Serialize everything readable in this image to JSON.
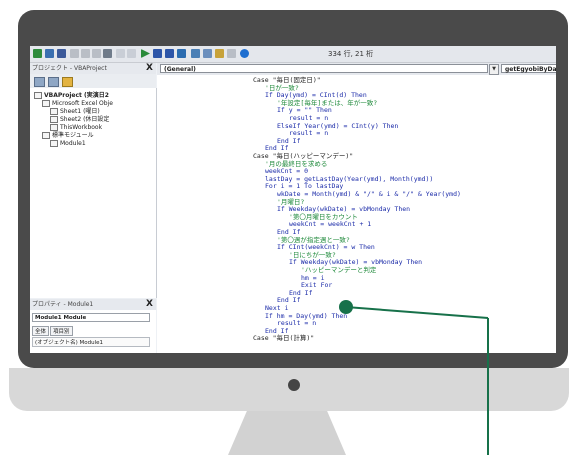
{
  "toolbar": {
    "cursor_position": "334 行, 21 桁"
  },
  "project_pane": {
    "title": "プロジェクト - VBAProject",
    "close": "X",
    "tree": [
      {
        "label": "VBAProject (実演日2",
        "indent": 0,
        "bold": true
      },
      {
        "label": "Microsoft Excel Obje",
        "indent": 1,
        "bold": false
      },
      {
        "label": "Sheet1 (曜日)",
        "indent": 2,
        "bold": false
      },
      {
        "label": "Sheet2 (休日設定",
        "indent": 2,
        "bold": false
      },
      {
        "label": "ThisWorkbook",
        "indent": 2,
        "bold": false
      },
      {
        "label": "標準モジュール",
        "indent": 1,
        "bold": false
      },
      {
        "label": "Module1",
        "indent": 2,
        "bold": false
      }
    ]
  },
  "properties_pane": {
    "title": "プロパティ - Module1",
    "close": "X",
    "selected": "Module1 Module",
    "tabs": [
      "全体",
      "項目別"
    ],
    "row": "(オブジェクト名)  Module1"
  },
  "code_pane": {
    "object_combo": "(General)",
    "procedure_combo": "getEgyobiByDa",
    "lines": [
      {
        "text": "Case \"毎日(固定日)\"",
        "type": "tx",
        "indent": 0
      },
      {
        "text": "'日が一致?",
        "type": "cm",
        "indent": 1
      },
      {
        "text": "If Day(ymd) = CInt(d) Then",
        "type": "kw",
        "indent": 1
      },
      {
        "text": "'年設定[毎年]または、年が一致?",
        "type": "cm",
        "indent": 2
      },
      {
        "text": "If y = \"\" Then",
        "type": "kw",
        "indent": 2
      },
      {
        "text": "result = n",
        "type": "kw",
        "indent": 3
      },
      {
        "text": "ElseIf Year(ymd) = CInt(y) Then",
        "type": "kw",
        "indent": 2
      },
      {
        "text": "result = n",
        "type": "kw",
        "indent": 3
      },
      {
        "text": "End If",
        "type": "kw",
        "indent": 2
      },
      {
        "text": "End If",
        "type": "kw",
        "indent": 1
      },
      {
        "text": "Case \"毎日(ハッピーマンデー)\"",
        "type": "tx",
        "indent": 0
      },
      {
        "text": "'月の最終日を求める",
        "type": "cm",
        "indent": 1
      },
      {
        "text": "weekCnt = 0",
        "type": "kw",
        "indent": 1
      },
      {
        "text": "lastDay = getLastDay(Year(ymd), Month(ymd))",
        "type": "kw",
        "indent": 1
      },
      {
        "text": "For i = 1 To lastDay",
        "type": "kw",
        "indent": 1
      },
      {
        "text": "wkDate = Month(ymd) & \"/\" & i & \"/\" & Year(ymd)",
        "type": "kw",
        "indent": 2
      },
      {
        "text": "'月曜日?",
        "type": "cm",
        "indent": 2
      },
      {
        "text": "If Weekday(wkDate) = vbMonday Then",
        "type": "kw",
        "indent": 2
      },
      {
        "text": "'第〇月曜日をカウント",
        "type": "cm",
        "indent": 3
      },
      {
        "text": "weekCnt = weekCnt + 1",
        "type": "kw",
        "indent": 3
      },
      {
        "text": "End If",
        "type": "kw",
        "indent": 2
      },
      {
        "text": "'第〇週が指定週と一致?",
        "type": "cm",
        "indent": 2
      },
      {
        "text": "If CInt(weekCnt) = w Then",
        "type": "kw",
        "indent": 2
      },
      {
        "text": "'日にちが一致?",
        "type": "cm",
        "indent": 3
      },
      {
        "text": "If Weekday(wkDate) = vbMonday Then",
        "type": "kw",
        "indent": 3
      },
      {
        "text": "'ハッピーマンデーと判定",
        "type": "cm",
        "indent": 4
      },
      {
        "text": "hm = i",
        "type": "kw",
        "indent": 4
      },
      {
        "text": "Exit For",
        "type": "kw",
        "indent": 4
      },
      {
        "text": "End If",
        "type": "kw",
        "indent": 3
      },
      {
        "text": "End If",
        "type": "kw",
        "indent": 2
      },
      {
        "text": "Next i",
        "type": "kw",
        "indent": 1
      },
      {
        "text": "If hm = Day(ymd) Then",
        "type": "kw",
        "indent": 1
      },
      {
        "text": "result = n",
        "type": "kw",
        "indent": 2
      },
      {
        "text": "End If",
        "type": "kw",
        "indent": 1
      },
      {
        "text": "Case \"毎日(計算)\"",
        "type": "tx",
        "indent": 0
      }
    ]
  },
  "colors": {
    "bezel": "#4a4a4a",
    "code_keyword": "#1a2aa8",
    "code_comment": "#1f8a3b",
    "callout": "#17714a"
  }
}
